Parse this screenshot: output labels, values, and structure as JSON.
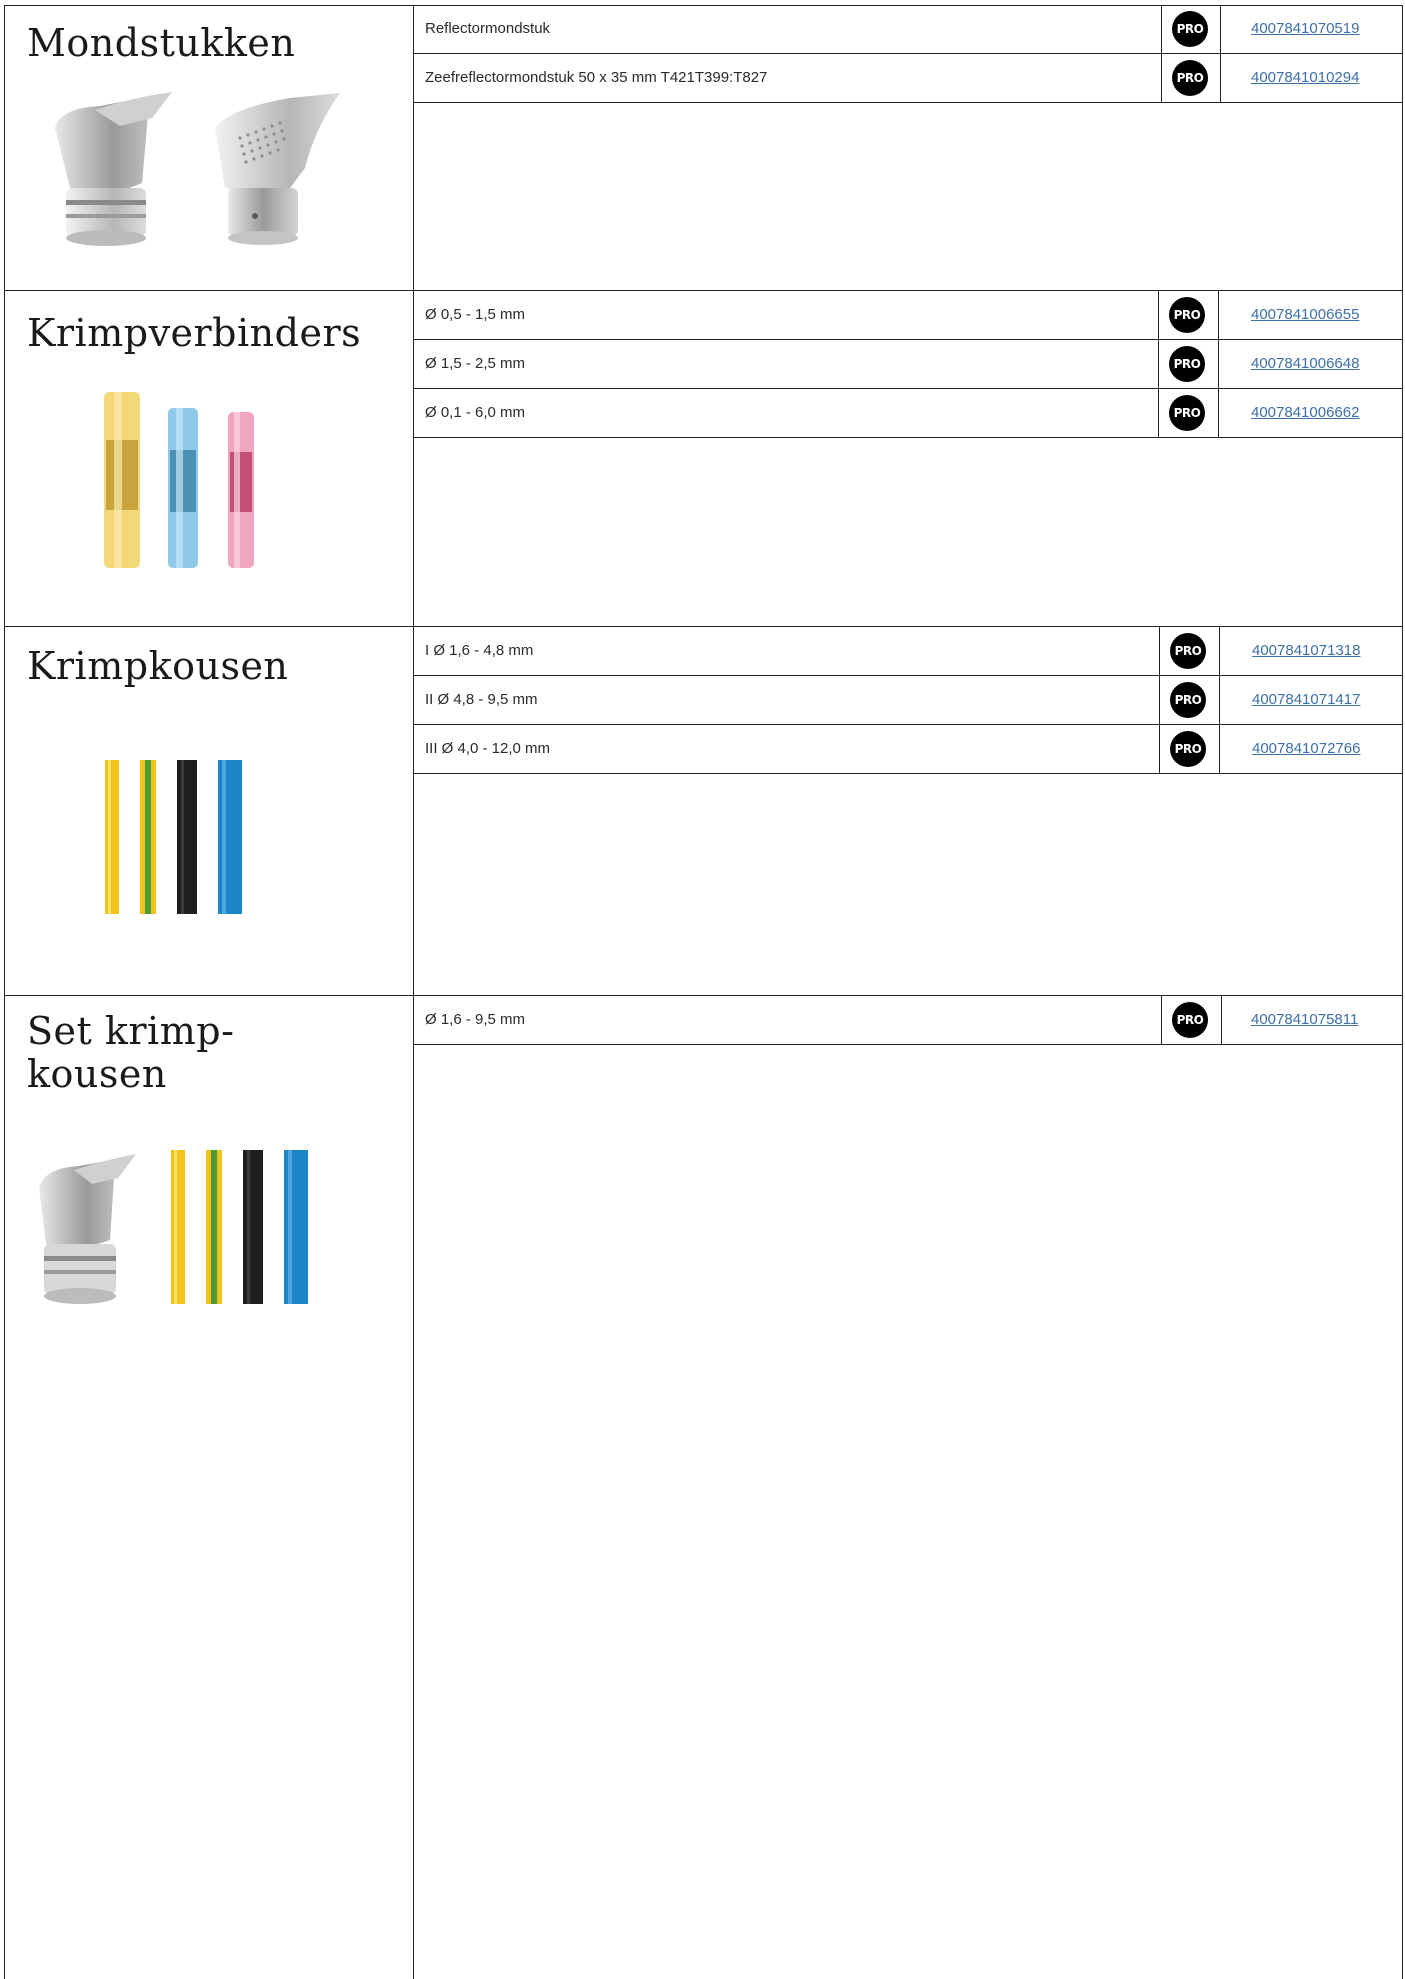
{
  "sections": [
    {
      "title_lines": [
        "Mondstukken"
      ],
      "rows": [
        {
          "desc": "Reflectormondstuk",
          "badge": "PRO",
          "ean": "4007841070519"
        },
        {
          "desc": "Zeefreflectormondstuk 50 x 35 mm T421T399:T827",
          "badge": "PRO",
          "ean": "4007841010294"
        }
      ]
    },
    {
      "title_lines": [
        "Krimpverbinders"
      ],
      "rows": [
        {
          "desc": "Ø 0,5 - 1,5 mm",
          "badge": "PRO",
          "ean": "4007841006655"
        },
        {
          "desc": "Ø 1,5 - 2,5 mm",
          "badge": "PRO",
          "ean": "4007841006648"
        },
        {
          "desc": "Ø 0,1 - 6,0 mm",
          "badge": "PRO",
          "ean": "4007841006662"
        }
      ]
    },
    {
      "title_lines": [
        "Krimpkousen"
      ],
      "rows": [
        {
          "desc": "I Ø 1,6 - 4,8 mm",
          "badge": "PRO",
          "ean": "4007841071318"
        },
        {
          "desc": "II Ø 4,8 - 9,5 mm",
          "badge": "PRO",
          "ean": "4007841071417"
        },
        {
          "desc": "III Ø 4,0 - 12,0 mm",
          "badge": "PRO",
          "ean": "4007841072766"
        }
      ]
    },
    {
      "title_lines": [
        "Set krimp-",
        "kousen"
      ],
      "rows": [
        {
          "desc": "Ø 1,6 - 9,5 mm",
          "badge": "PRO",
          "ean": "4007841075811"
        }
      ]
    }
  ],
  "colors": {
    "link": "#3d6fa8",
    "badge_bg": "#000000",
    "tube_yellow": "#f2c417",
    "tube_green": "#4a9a3a",
    "tube_black": "#1e1e1e",
    "tube_blue": "#1a86c8",
    "connector_yellow": "#f3d87a",
    "connector_blue": "#8fcbe8",
    "connector_pink": "#f0a6c0"
  }
}
